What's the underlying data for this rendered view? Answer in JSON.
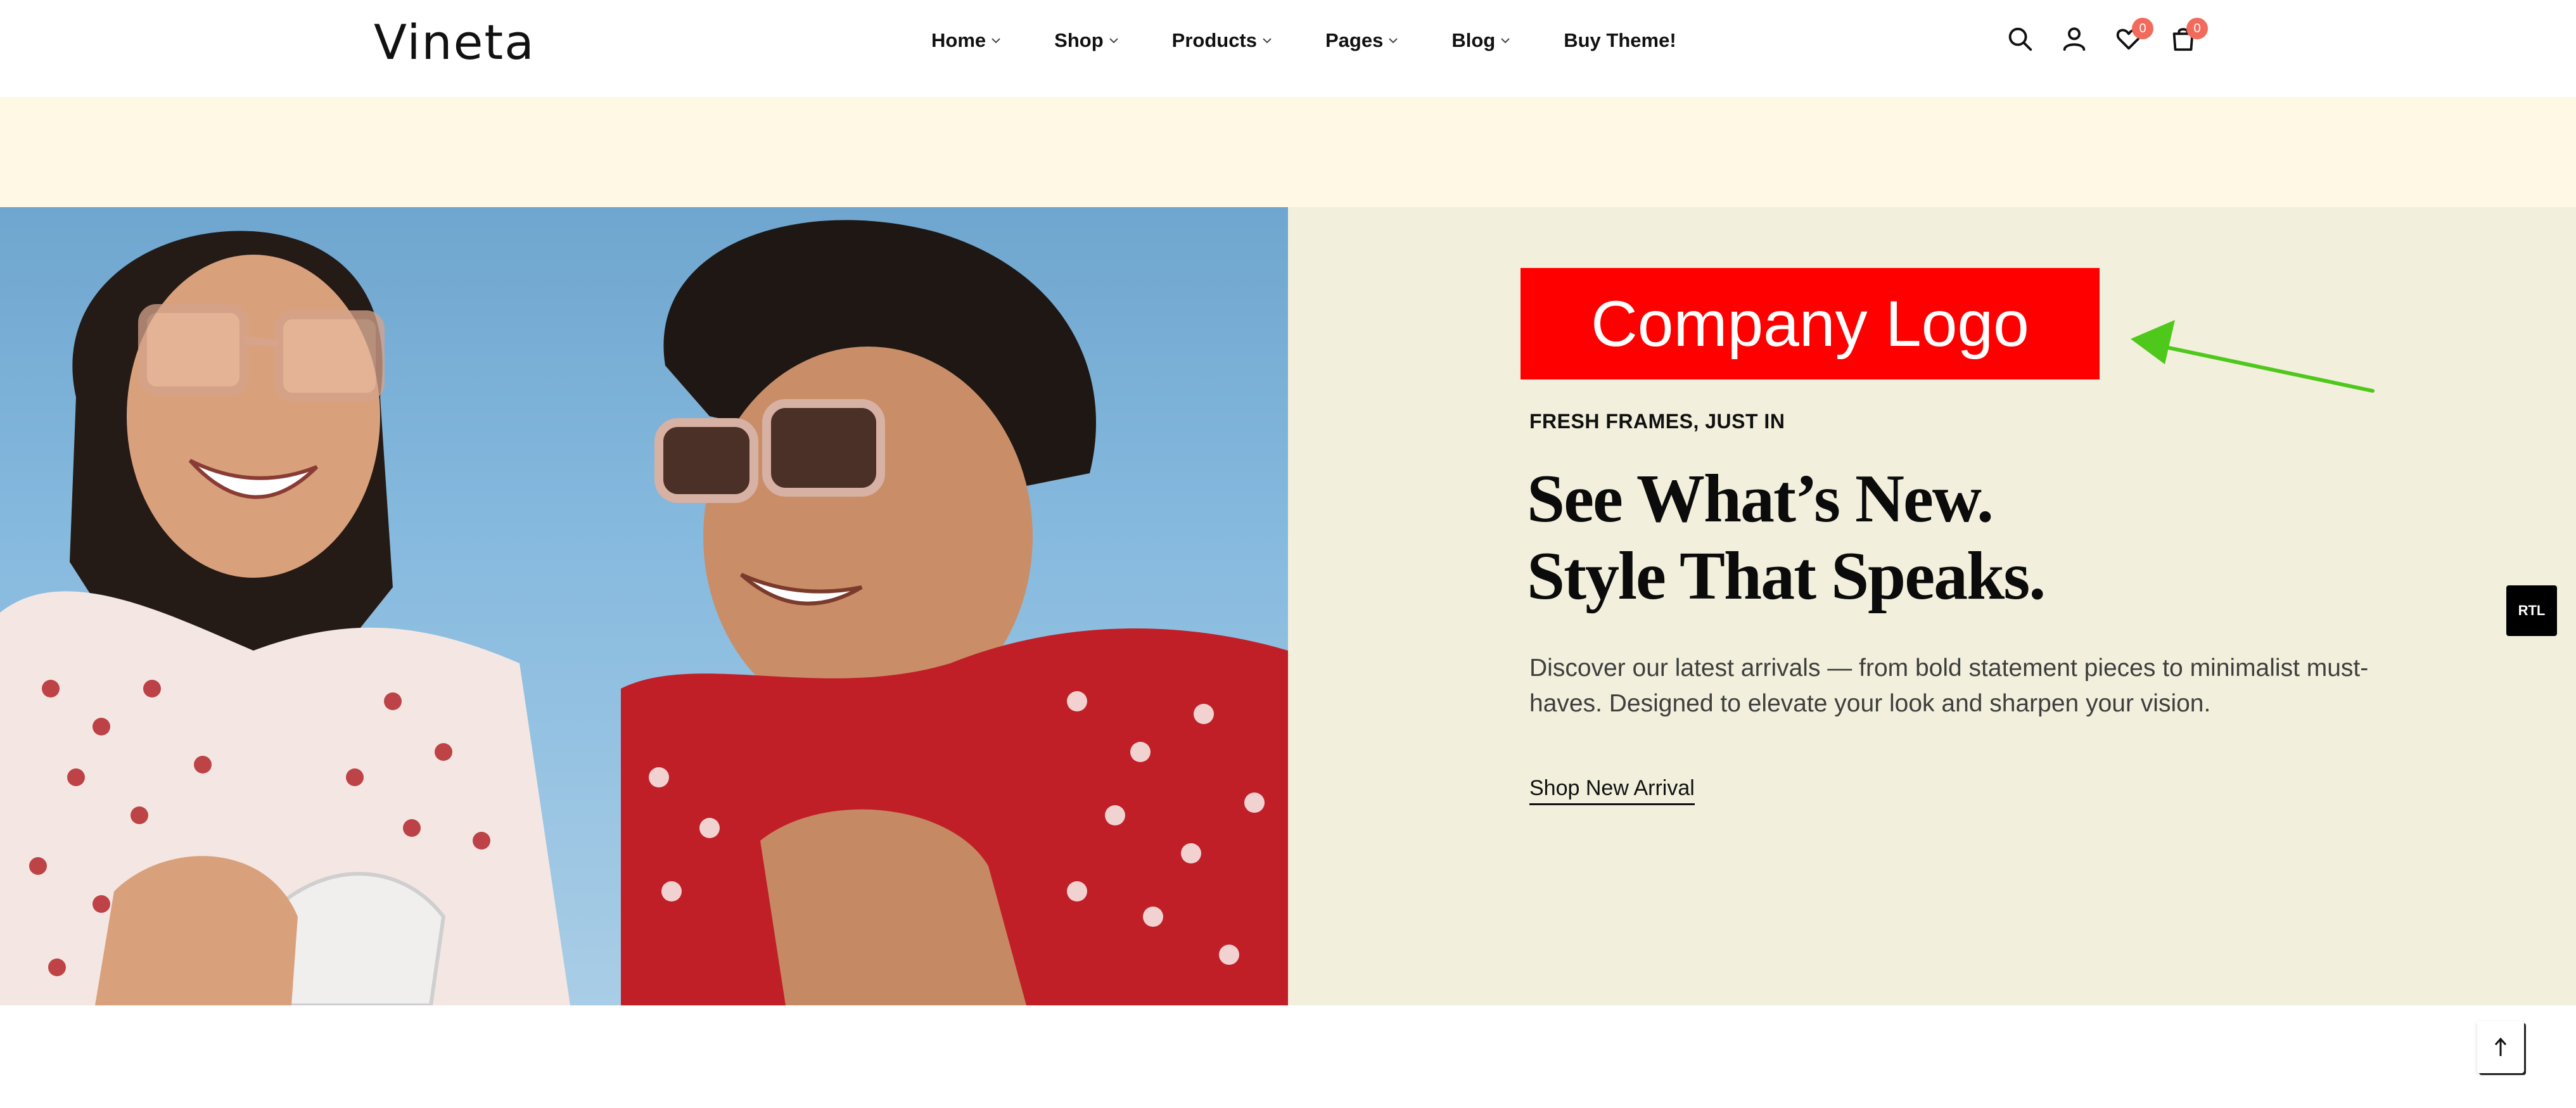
{
  "header": {
    "brand": "Vineta",
    "nav": [
      {
        "label": "Home",
        "has_dropdown": true
      },
      {
        "label": "Shop",
        "has_dropdown": true
      },
      {
        "label": "Products",
        "has_dropdown": true
      },
      {
        "label": "Pages",
        "has_dropdown": true
      },
      {
        "label": "Blog",
        "has_dropdown": true
      },
      {
        "label": "Buy Theme!",
        "has_dropdown": false
      }
    ],
    "icons": {
      "search": "search-icon",
      "account": "user-icon",
      "wishlist": "heart-icon",
      "cart": "cart-icon"
    },
    "wishlist_count": "0",
    "cart_count": "0"
  },
  "hero": {
    "logo_text": "Company Logo",
    "eyebrow": "FRESH FRAMES, JUST IN",
    "headline_line1": "See What’s New.",
    "headline_line2": "Style That Speaks.",
    "description": "Discover our latest arrivals — from bold statement pieces to minimalist must-haves. Designed to elevate your look and sharpen your vision.",
    "cta_label": "Shop New Arrival"
  },
  "floating": {
    "rtl_label": "RTL",
    "back_to_top_icon": "arrow-up-icon"
  },
  "colors": {
    "announcement_bg": "#fef8e5",
    "hero_bg": "#f2f0dc",
    "logo_bg": "#ff0000",
    "badge": "#f16a5c",
    "arrow": "#4fc81c"
  }
}
